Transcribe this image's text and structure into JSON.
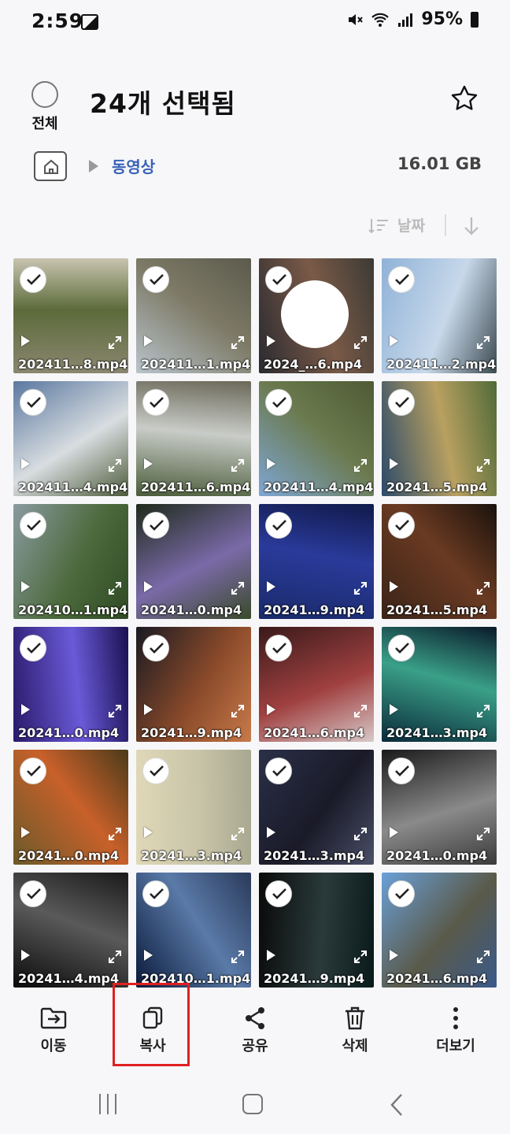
{
  "status_bar": {
    "time": "2:59",
    "battery": "95%"
  },
  "header": {
    "select_all_label": "전체",
    "title": "24개 선택됨"
  },
  "path": {
    "folder": "동영상",
    "size": "16.01 GB"
  },
  "sort": {
    "label": "날짜"
  },
  "files": [
    {
      "name": "202411…8.mp4",
      "colors": [
        "#8a8770",
        "#5c6b3a",
        "#c8c4b0"
      ],
      "blob": false
    },
    {
      "name": "202411…1.mp4",
      "colors": [
        "#b9c4cc",
        "#7d7a66",
        "#5b5a4c"
      ],
      "blob": false
    },
    {
      "name": "2024_…6.mp4",
      "colors": [
        "#2a2a30",
        "#7a5a48",
        "#3c3a34"
      ],
      "blob": true
    },
    {
      "name": "202411…2.mp4",
      "colors": [
        "#8fb2d8",
        "#c7d8ea",
        "#3c4a50"
      ],
      "blob": false
    },
    {
      "name": "202411…4.mp4",
      "colors": [
        "#5a78a0",
        "#d8dde0",
        "#4d5b3a"
      ],
      "blob": false
    },
    {
      "name": "202411…6.mp4",
      "colors": [
        "#4a5c3a",
        "#c9ccc8",
        "#6a6858"
      ],
      "blob": false
    },
    {
      "name": "202411…4.mp4",
      "colors": [
        "#7ea6d4",
        "#6b7a4e",
        "#4d5a34"
      ],
      "blob": false
    },
    {
      "name": "20241…5.mp4",
      "colors": [
        "#2c4a6a",
        "#b8a060",
        "#506a38"
      ],
      "blob": false
    },
    {
      "name": "202410…1.mp4",
      "colors": [
        "#8a9aa0",
        "#4c6a3c",
        "#2e4a24"
      ],
      "blob": false
    },
    {
      "name": "20241…0.mp4",
      "colors": [
        "#1e2a1a",
        "#7a6aa8",
        "#3a4a2a"
      ],
      "blob": false
    },
    {
      "name": "20241…9.mp4",
      "colors": [
        "#1a2a6a",
        "#2a3a9a",
        "#101a4a"
      ],
      "blob": false
    },
    {
      "name": "20241…5.mp4",
      "colors": [
        "#3a2418",
        "#6a3a22",
        "#1a120c"
      ],
      "blob": false
    },
    {
      "name": "20241…0.mp4",
      "colors": [
        "#2a1a6a",
        "#6a5ad8",
        "#1a1050"
      ],
      "blob": false
    },
    {
      "name": "20241…9.mp4",
      "colors": [
        "#1a1a22",
        "#8a4a2a",
        "#c87a4a"
      ],
      "blob": false
    },
    {
      "name": "20241…6.mp4",
      "colors": [
        "#3a1a1a",
        "#a04040",
        "#d8c8c8"
      ],
      "blob": false
    },
    {
      "name": "20241…3.mp4",
      "colors": [
        "#0a2a3a",
        "#3aa088",
        "#0a1a2a"
      ],
      "blob": false
    },
    {
      "name": "20241…0.mp4",
      "colors": [
        "#6a5a2a",
        "#c8602a",
        "#4a3a1a"
      ],
      "blob": false
    },
    {
      "name": "20241…3.mp4",
      "colors": [
        "#e0d8b8",
        "#c8c4a8",
        "#a8a890"
      ],
      "blob": false
    },
    {
      "name": "20241…3.mp4",
      "colors": [
        "#2a3048",
        "#1a1a28",
        "#4a5068"
      ],
      "blob": false
    },
    {
      "name": "20241…0.mp4",
      "colors": [
        "#1a1a1a",
        "#8a8a8a",
        "#3a3a3a"
      ],
      "blob": false
    },
    {
      "name": "20241…4.mp4",
      "colors": [
        "#0a0a0a",
        "#5a5a5a",
        "#1a1a1a"
      ],
      "blob": false
    },
    {
      "name": "202410…1.mp4",
      "colors": [
        "#0a1a3a",
        "#5a7aa8",
        "#2a3a5a"
      ],
      "blob": false
    },
    {
      "name": "20241…9.mp4",
      "colors": [
        "#0a0a0a",
        "#2a3a3a",
        "#0a1a1a"
      ],
      "blob": false
    },
    {
      "name": "20241…6.mp4",
      "colors": [
        "#6aa0d8",
        "#5a5a4a",
        "#3a5a8a"
      ],
      "blob": false
    }
  ],
  "bottom_actions": [
    {
      "label": "이동",
      "icon": "move-icon"
    },
    {
      "label": "복사",
      "icon": "copy-icon"
    },
    {
      "label": "공유",
      "icon": "share-icon"
    },
    {
      "label": "삭제",
      "icon": "delete-icon"
    },
    {
      "label": "더보기",
      "icon": "more-icon"
    }
  ]
}
